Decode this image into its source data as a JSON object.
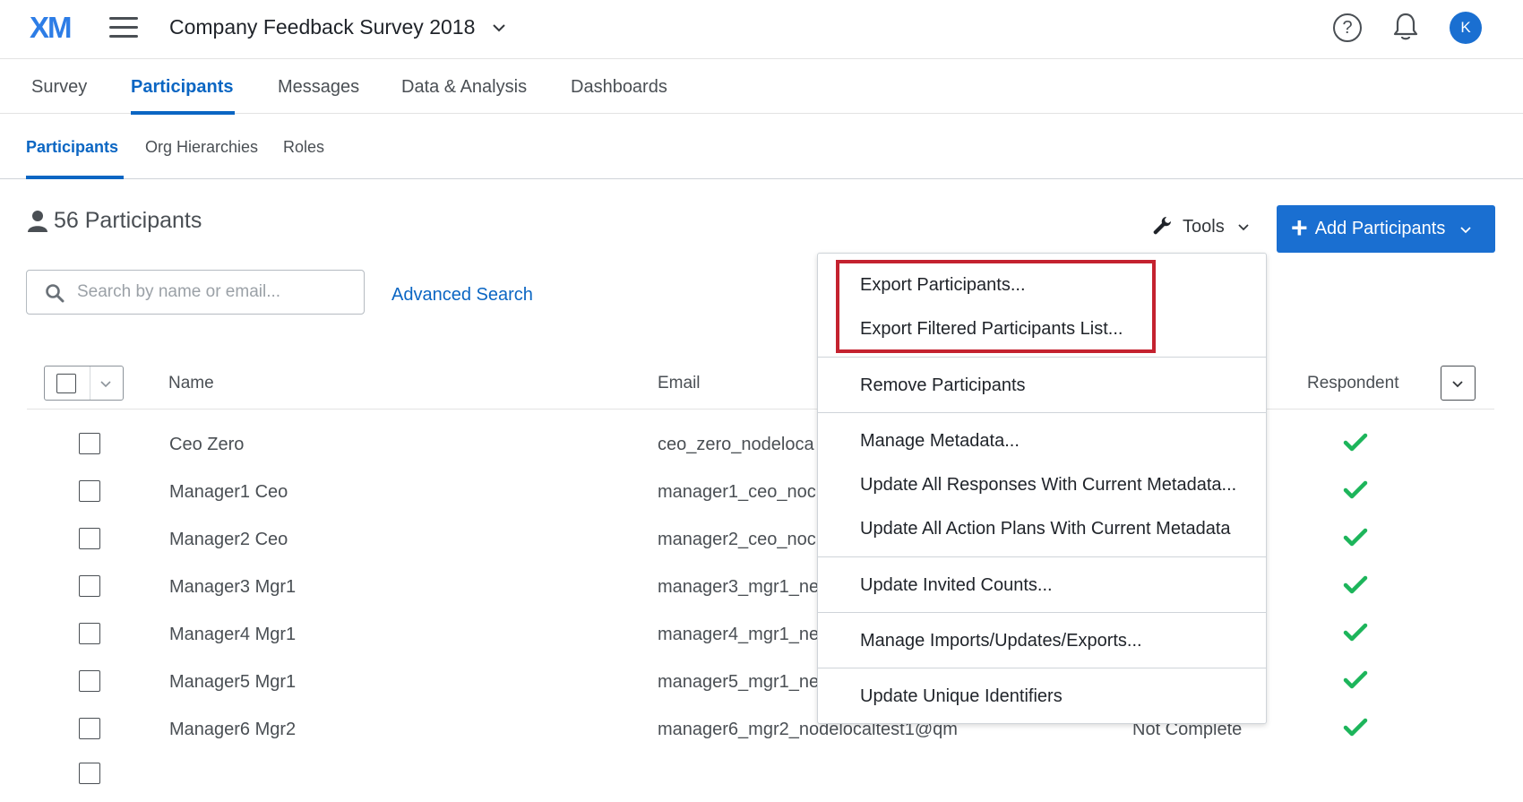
{
  "header": {
    "logo": "XM",
    "project_title": "Company Feedback Survey 2018",
    "avatar_initial": "K"
  },
  "main_tabs": [
    {
      "label": "Survey",
      "active": false
    },
    {
      "label": "Participants",
      "active": true
    },
    {
      "label": "Messages",
      "active": false
    },
    {
      "label": "Data & Analysis",
      "active": false
    },
    {
      "label": "Dashboards",
      "active": false
    }
  ],
  "sub_tabs": [
    {
      "label": "Participants",
      "active": true
    },
    {
      "label": "Org Hierarchies",
      "active": false
    },
    {
      "label": "Roles",
      "active": false
    }
  ],
  "participants": {
    "count_label": "56 Participants"
  },
  "toolbar": {
    "tools_label": "Tools",
    "add_label": "Add Participants"
  },
  "search": {
    "placeholder": "Search by name or email...",
    "advanced_label": "Advanced Search"
  },
  "table": {
    "columns": {
      "name": "Name",
      "email": "Email",
      "respondent": "Respondent"
    },
    "rows": [
      {
        "name": "Ceo Zero",
        "email": "ceo_zero_nodeloca",
        "status": "",
        "respondent": true
      },
      {
        "name": "Manager1 Ceo",
        "email": "manager1_ceo_noc",
        "status": "",
        "respondent": true
      },
      {
        "name": "Manager2 Ceo",
        "email": "manager2_ceo_noc",
        "status": "",
        "respondent": true
      },
      {
        "name": "Manager3 Mgr1",
        "email": "manager3_mgr1_ne",
        "status": "",
        "respondent": true
      },
      {
        "name": "Manager4 Mgr1",
        "email": "manager4_mgr1_ne",
        "status": "",
        "respondent": true
      },
      {
        "name": "Manager5 Mgr1",
        "email": "manager5_mgr1_ne",
        "status": "",
        "respondent": true
      },
      {
        "name": "Manager6 Mgr2",
        "email": "manager6_mgr2_nodelocaltest1@qm",
        "status": "Not Complete",
        "respondent": true
      }
    ]
  },
  "tools_menu": {
    "items": [
      "Export Participants...",
      "Export Filtered Participants List...",
      "Remove Participants",
      "Manage Metadata...",
      "Update All Responses With Current Metadata...",
      "Update All Action Plans With Current Metadata",
      "Update Invited Counts...",
      "Manage Imports/Updates/Exports...",
      "Update Unique Identifiers"
    ]
  },
  "colors": {
    "accent": "#0b66c3",
    "button": "#1a6fd1",
    "check": "#1db55b",
    "highlight": "#c4222f"
  }
}
